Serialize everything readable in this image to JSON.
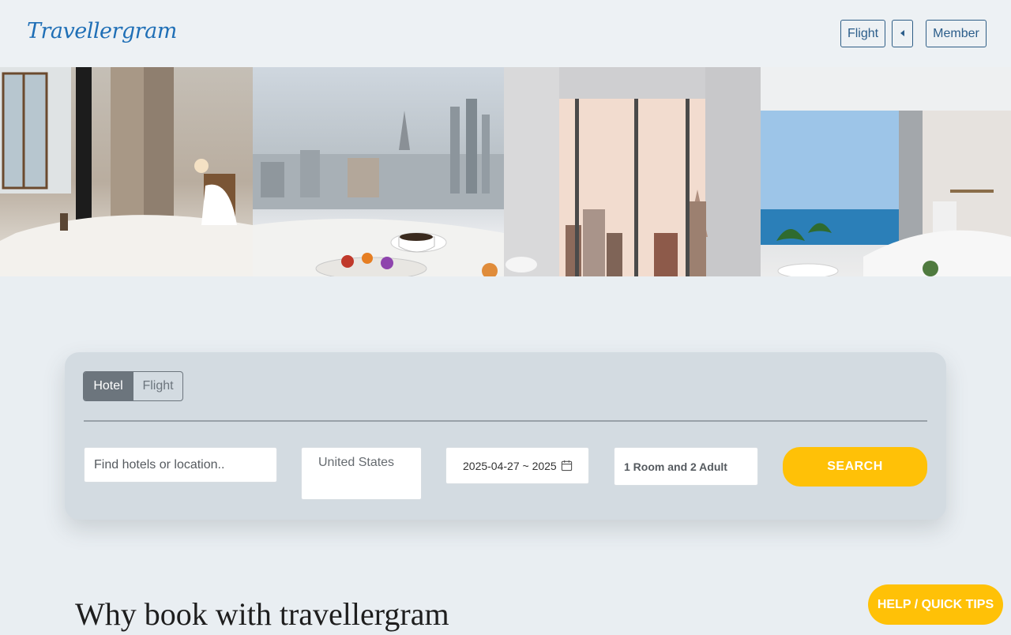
{
  "header": {
    "logo_text": "Travellergram",
    "flight_label": "Flight",
    "member_label": "Member"
  },
  "hero": {
    "images": [
      {
        "name": "hotel-bedroom-image"
      },
      {
        "name": "breakfast-city-view-image"
      },
      {
        "name": "city-skyline-room-image"
      },
      {
        "name": "ocean-view-living-room-image"
      }
    ]
  },
  "search": {
    "tabs": [
      {
        "label": "Hotel",
        "active": true
      },
      {
        "label": "Flight",
        "active": false
      }
    ],
    "location_placeholder": "Find hotels or location..",
    "country_value": "United States",
    "date_value": "2025-04-27 ~ 2025",
    "guests_value": "1 Room and 2 Adult",
    "search_label": "SEARCH"
  },
  "why_heading": "Why book with travellergram",
  "help_label": "HELP / QUICK TIPS",
  "colors": {
    "accent": "#ffc107",
    "brand": "#1f6fb6",
    "tab_active": "#6c757d"
  }
}
